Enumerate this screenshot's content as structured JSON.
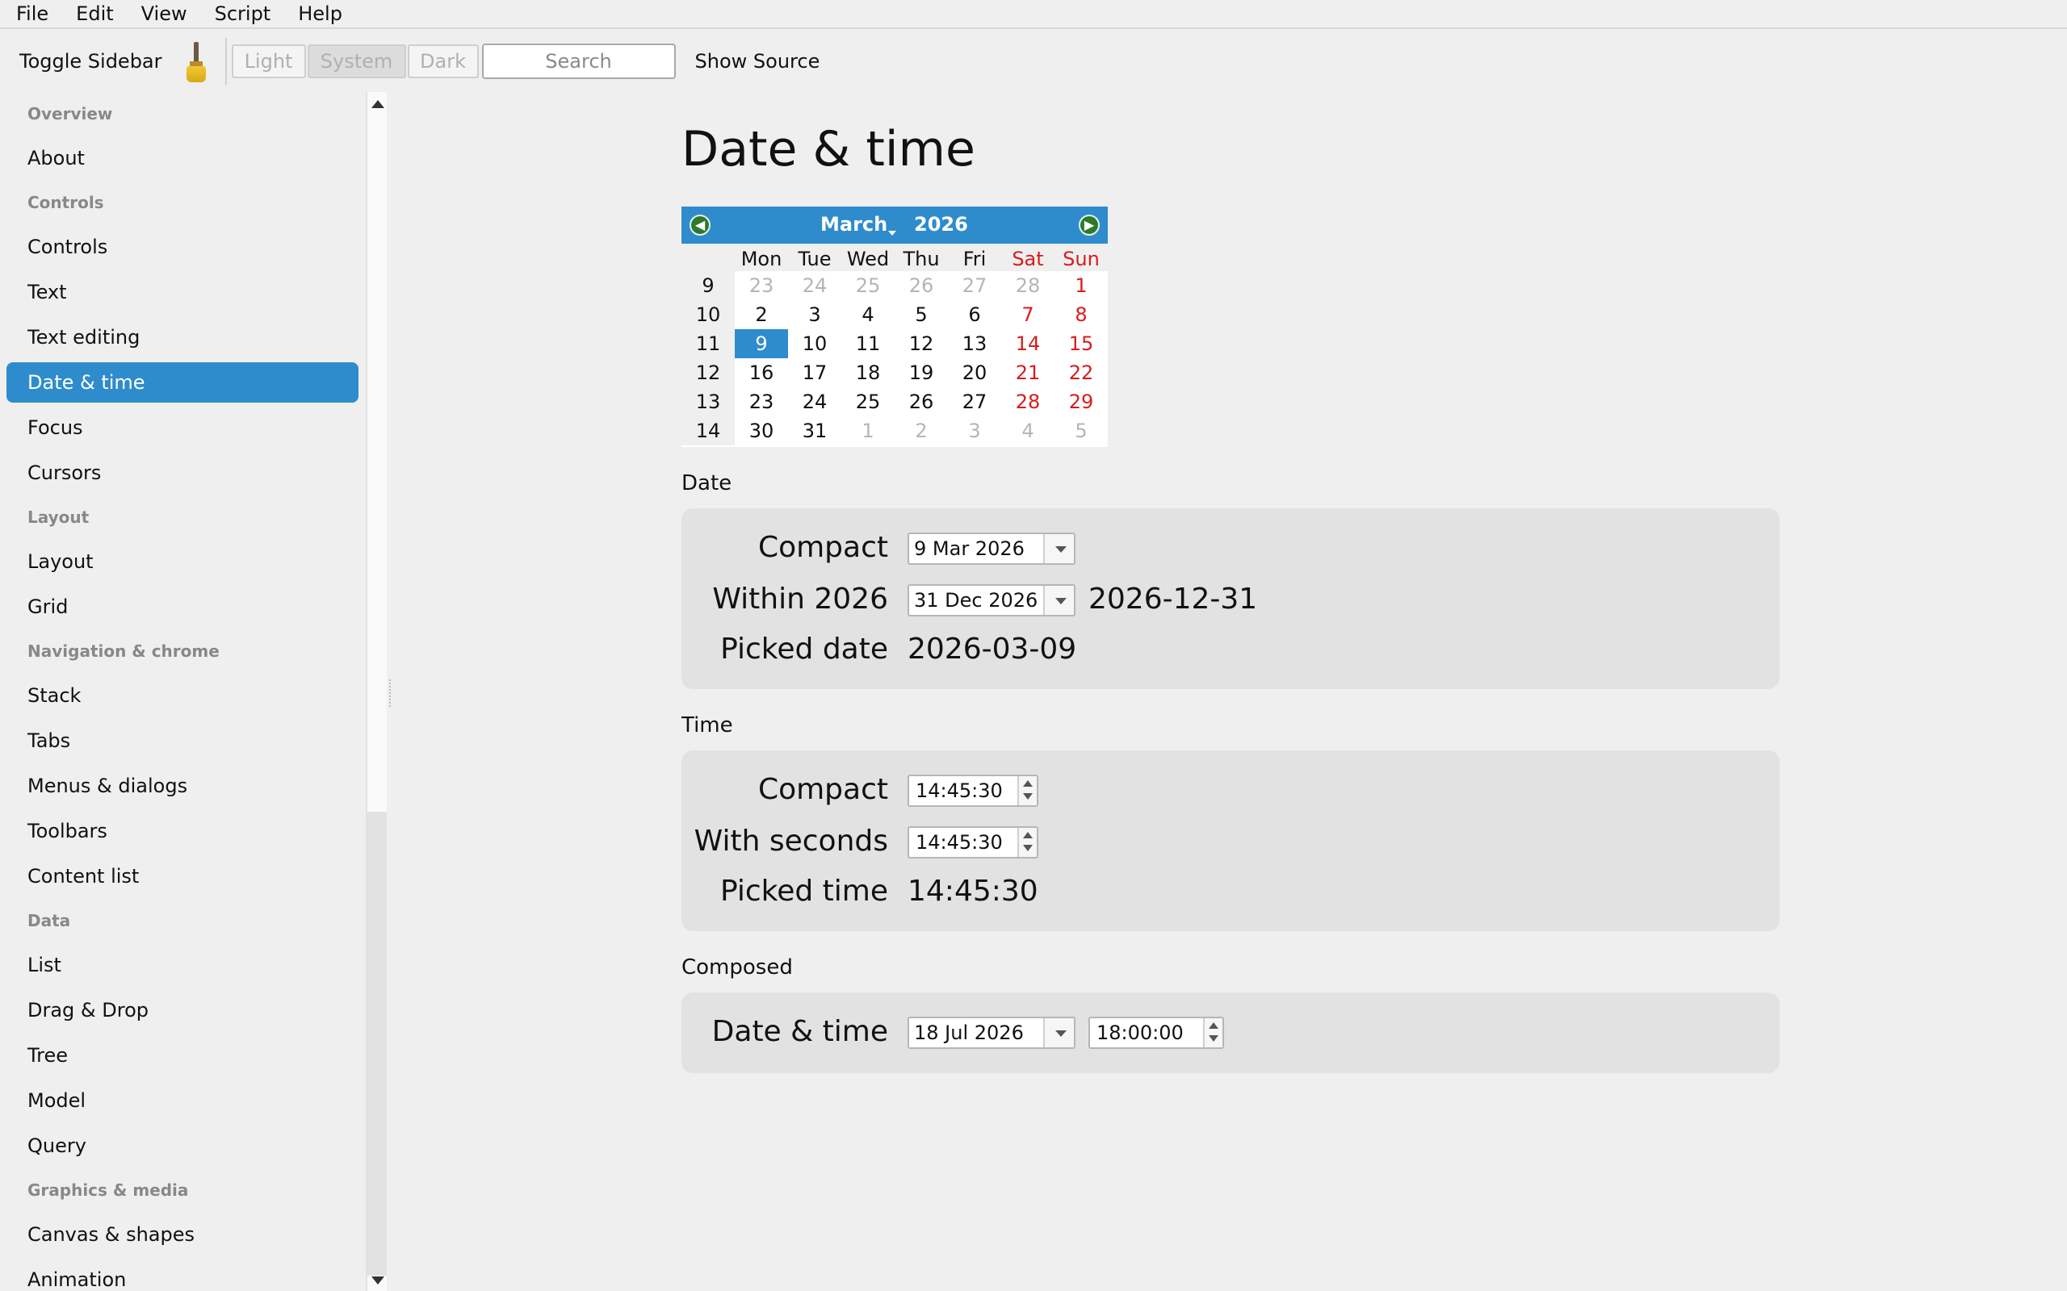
{
  "menubar": {
    "items": [
      "File",
      "Edit",
      "View",
      "Script",
      "Help"
    ]
  },
  "toolbar": {
    "toggle_sidebar": "Toggle Sidebar",
    "theme_light": "Light",
    "theme_system": "System",
    "theme_dark": "Dark",
    "search_placeholder": "Search",
    "show_source": "Show Source",
    "brush_icon": "paintbrush-icon"
  },
  "sidebar": {
    "items": [
      {
        "type": "header",
        "label": "Overview"
      },
      {
        "type": "item",
        "label": "About"
      },
      {
        "type": "header",
        "label": "Controls"
      },
      {
        "type": "item",
        "label": "Controls"
      },
      {
        "type": "item",
        "label": "Text"
      },
      {
        "type": "item",
        "label": "Text editing"
      },
      {
        "type": "item",
        "label": "Date & time",
        "active": true
      },
      {
        "type": "item",
        "label": "Focus"
      },
      {
        "type": "item",
        "label": "Cursors"
      },
      {
        "type": "header",
        "label": "Layout"
      },
      {
        "type": "item",
        "label": "Layout"
      },
      {
        "type": "item",
        "label": "Grid"
      },
      {
        "type": "header",
        "label": "Navigation & chrome"
      },
      {
        "type": "item",
        "label": "Stack"
      },
      {
        "type": "item",
        "label": "Tabs"
      },
      {
        "type": "item",
        "label": "Menus & dialogs"
      },
      {
        "type": "item",
        "label": "Toolbars"
      },
      {
        "type": "item",
        "label": "Content list"
      },
      {
        "type": "header",
        "label": "Data"
      },
      {
        "type": "item",
        "label": "List"
      },
      {
        "type": "item",
        "label": "Drag & Drop"
      },
      {
        "type": "item",
        "label": "Tree"
      },
      {
        "type": "item",
        "label": "Model"
      },
      {
        "type": "item",
        "label": "Query"
      },
      {
        "type": "header",
        "label": "Graphics & media"
      },
      {
        "type": "item",
        "label": "Canvas & shapes"
      },
      {
        "type": "item",
        "label": "Animation"
      }
    ]
  },
  "main": {
    "title": "Date & time",
    "calendar": {
      "month": "March",
      "year": "2026",
      "weekdays": [
        "Mon",
        "Tue",
        "Wed",
        "Thu",
        "Fri",
        "Sat",
        "Sun"
      ],
      "weeks": [
        {
          "num": "9",
          "days": [
            {
              "d": "23",
              "out": true
            },
            {
              "d": "24",
              "out": true
            },
            {
              "d": "25",
              "out": true
            },
            {
              "d": "26",
              "out": true
            },
            {
              "d": "27",
              "out": true
            },
            {
              "d": "28",
              "out": true
            },
            {
              "d": "1"
            }
          ]
        },
        {
          "num": "10",
          "days": [
            {
              "d": "2"
            },
            {
              "d": "3"
            },
            {
              "d": "4"
            },
            {
              "d": "5"
            },
            {
              "d": "6"
            },
            {
              "d": "7"
            },
            {
              "d": "8"
            }
          ]
        },
        {
          "num": "11",
          "days": [
            {
              "d": "9",
              "selected": true
            },
            {
              "d": "10"
            },
            {
              "d": "11"
            },
            {
              "d": "12"
            },
            {
              "d": "13"
            },
            {
              "d": "14"
            },
            {
              "d": "15"
            }
          ]
        },
        {
          "num": "12",
          "days": [
            {
              "d": "16"
            },
            {
              "d": "17"
            },
            {
              "d": "18"
            },
            {
              "d": "19"
            },
            {
              "d": "20"
            },
            {
              "d": "21"
            },
            {
              "d": "22"
            }
          ]
        },
        {
          "num": "13",
          "days": [
            {
              "d": "23"
            },
            {
              "d": "24"
            },
            {
              "d": "25"
            },
            {
              "d": "26"
            },
            {
              "d": "27"
            },
            {
              "d": "28"
            },
            {
              "d": "29"
            }
          ]
        },
        {
          "num": "14",
          "days": [
            {
              "d": "30"
            },
            {
              "d": "31"
            },
            {
              "d": "1",
              "out": true
            },
            {
              "d": "2",
              "out": true
            },
            {
              "d": "3",
              "out": true
            },
            {
              "d": "4",
              "out": true
            },
            {
              "d": "5",
              "out": true
            }
          ]
        }
      ]
    },
    "date_section": {
      "label": "Date",
      "compact_label": "Compact",
      "compact_value": "9 Mar 2026",
      "within_label": "Within 2026",
      "within_value": "31 Dec 2026",
      "within_iso": "2026-12-31",
      "picked_label": "Picked date",
      "picked_value": "2026-03-09"
    },
    "time_section": {
      "label": "Time",
      "compact_label": "Compact",
      "compact_value": "14:45:30",
      "seconds_label": "With seconds",
      "seconds_value": "14:45:30",
      "picked_label": "Picked time",
      "picked_value": "14:45:30"
    },
    "composed_section": {
      "label": "Composed",
      "datetime_label": "Date & time",
      "date_value": "18 Jul 2026",
      "time_value": "18:00:00"
    }
  },
  "colors": {
    "accent": "#2f8ccc",
    "weekend": "#d81c1c",
    "nav_button": "#2d7a2d"
  }
}
